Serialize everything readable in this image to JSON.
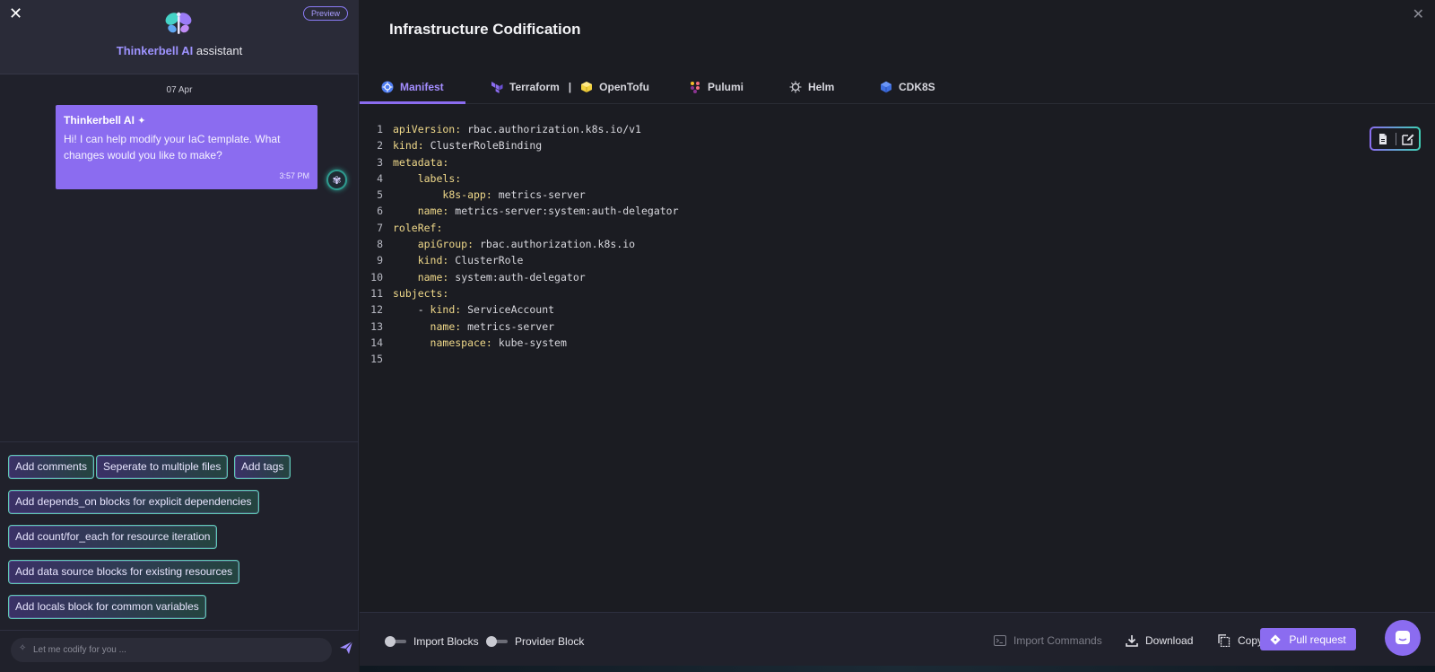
{
  "assistant": {
    "close_icon": "close-icon",
    "preview_badge": "Preview",
    "brand_name": "Thinkerbell AI",
    "brand_suffix": "assistant",
    "date": "07 Apr",
    "message": {
      "sender": "Thinkerbell AI",
      "text": "Hi! I can help modify your IaC template. What changes would you like to make?",
      "time": "3:57 PM"
    },
    "suggestions": [
      "Add comments",
      "Seperate to multiple files",
      "Add tags",
      "Add depends_on blocks for explicit dependencies",
      "Add count/for_each for resource iteration",
      "Add data source blocks for existing resources",
      "Add locals block for common variables"
    ],
    "input_placeholder": "Let me codify for you ..."
  },
  "main": {
    "title": "Infrastructure Codification",
    "tabs": [
      {
        "label": "Manifest",
        "icon": "kubernetes-icon",
        "active": true
      },
      {
        "label": "Terraform",
        "icon": "terraform-icon",
        "active": false
      },
      {
        "label": "OpenTofu",
        "icon": "opentofu-icon",
        "active": false
      },
      {
        "label": "Pulumi",
        "icon": "pulumi-icon",
        "active": false
      },
      {
        "label": "Helm",
        "icon": "helm-icon",
        "active": false
      },
      {
        "label": "CDK8S",
        "icon": "cdk8s-icon",
        "active": false
      }
    ],
    "tab_separator": "|",
    "code_lines": [
      {
        "n": "1",
        "indent": "",
        "key": "apiVersion",
        "value": "rbac.authorization.k8s.io/v1"
      },
      {
        "n": "2",
        "indent": "",
        "key": "kind",
        "value": "ClusterRoleBinding"
      },
      {
        "n": "3",
        "indent": "",
        "key": "metadata",
        "value": ""
      },
      {
        "n": "4",
        "indent": "    ",
        "key": "labels",
        "value": ""
      },
      {
        "n": "5",
        "indent": "        ",
        "key": "k8s-app",
        "value": "metrics-server"
      },
      {
        "n": "6",
        "indent": "    ",
        "key": "name",
        "value": "metrics-server:system:auth-delegator"
      },
      {
        "n": "7",
        "indent": "",
        "key": "roleRef",
        "value": ""
      },
      {
        "n": "8",
        "indent": "    ",
        "key": "apiGroup",
        "value": "rbac.authorization.k8s.io"
      },
      {
        "n": "9",
        "indent": "    ",
        "key": "kind",
        "value": "ClusterRole"
      },
      {
        "n": "10",
        "indent": "    ",
        "key": "name",
        "value": "system:auth-delegator"
      },
      {
        "n": "11",
        "indent": "",
        "key": "subjects",
        "value": ""
      },
      {
        "n": "12",
        "indent": "    - ",
        "key": "kind",
        "value": "ServiceAccount"
      },
      {
        "n": "13",
        "indent": "      ",
        "key": "name",
        "value": "metrics-server"
      },
      {
        "n": "14",
        "indent": "      ",
        "key": "namespace",
        "value": "kube-system"
      },
      {
        "n": "15",
        "indent": "",
        "key": "",
        "value": ""
      }
    ],
    "bottom": {
      "toggle_import_blocks": "Import Blocks",
      "toggle_provider_block": "Provider Block",
      "import_commands": "Import Commands",
      "download": "Download",
      "copy": "Copy",
      "pull_request": "Pull request"
    }
  },
  "colors": {
    "accent": "#8b6cf0",
    "teal": "#3fd0b5",
    "yaml_key": "#f0d98a"
  }
}
